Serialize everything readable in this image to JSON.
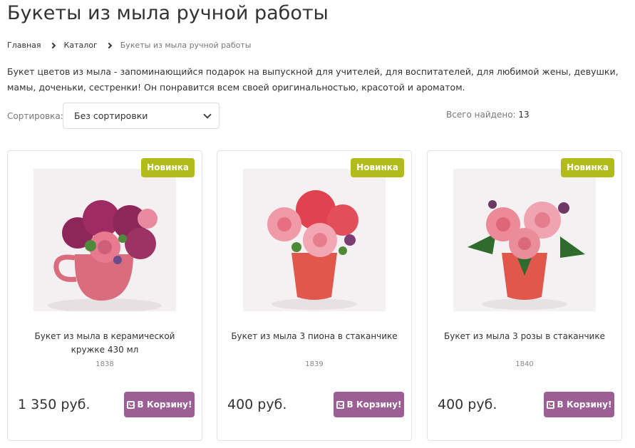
{
  "page": {
    "title": "Букеты из мыла ручной работы",
    "description": "Букет цветов из мыла -  запоминающийся подарок на выпускной для учителей, для воспитателей, для любимой жены, девушки, мамы, доченьки, сестренки! Он понравится всем своей оригинальностью, красотой и ароматом."
  },
  "breadcrumb": {
    "items": [
      "Главная",
      "Каталог"
    ],
    "current": "Букеты из мыла ручной работы"
  },
  "sort": {
    "label": "Сортировка:",
    "selected": "Без сортировки"
  },
  "found": {
    "label": "Всего найдено:",
    "count": "13"
  },
  "products": [
    {
      "badge": "Новинка",
      "name": "Букет из мыла в керамической кружке 430 мл",
      "sku": "1838",
      "price": "1 350 руб.",
      "button": "В Корзину!"
    },
    {
      "badge": "Новинка",
      "name": "Букет из мыла 3 пиона в стаканчике",
      "sku": "1839",
      "price": "400 руб.",
      "button": "В Корзину!"
    },
    {
      "badge": "Новинка",
      "name": "Букет из мыла 3 розы в стаканчике",
      "sku": "1840",
      "price": "400 руб.",
      "button": "В Корзину!"
    }
  ],
  "colors": {
    "badge": "#b2bb1c",
    "cart_button": "#9b5f96"
  }
}
